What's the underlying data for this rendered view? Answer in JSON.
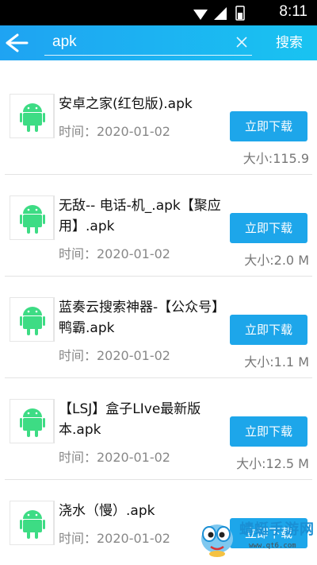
{
  "status_bar": {
    "time": "8:11",
    "battery_level": 0.35
  },
  "search": {
    "query": "apk",
    "button_label": "搜索"
  },
  "items": [
    {
      "title": "安卓之家(红包版).apk",
      "time": "时间：2020-01-02",
      "button": "立即下载",
      "size": "大小:115.9"
    },
    {
      "title": "无敌-- 电话-机_.apk【聚应用】.apk",
      "time": "时间：2020-01-02",
      "button": "立即下载",
      "size": "大小:2.0 M"
    },
    {
      "title": "蓝奏云搜索神器-【公众号】鸭霸.apk",
      "time": "时间：2020-01-02",
      "button": "立即下载",
      "size": "大小:1.1 M"
    },
    {
      "title": "【LSJ】盒子LIve最新版本.apk",
      "time": "时间：2020-01-02",
      "button": "立即下载",
      "size": "大小:12.5 M"
    },
    {
      "title": "浇水（慢）.apk",
      "time": "时间：2020-01-02",
      "button": "立即下载",
      "size": ""
    }
  ],
  "watermark": {
    "name": "蜻蜓手游网",
    "url": "www.qt6.com"
  },
  "colors": {
    "accent": "#1da6ea",
    "android_green": "#3ddc84"
  }
}
